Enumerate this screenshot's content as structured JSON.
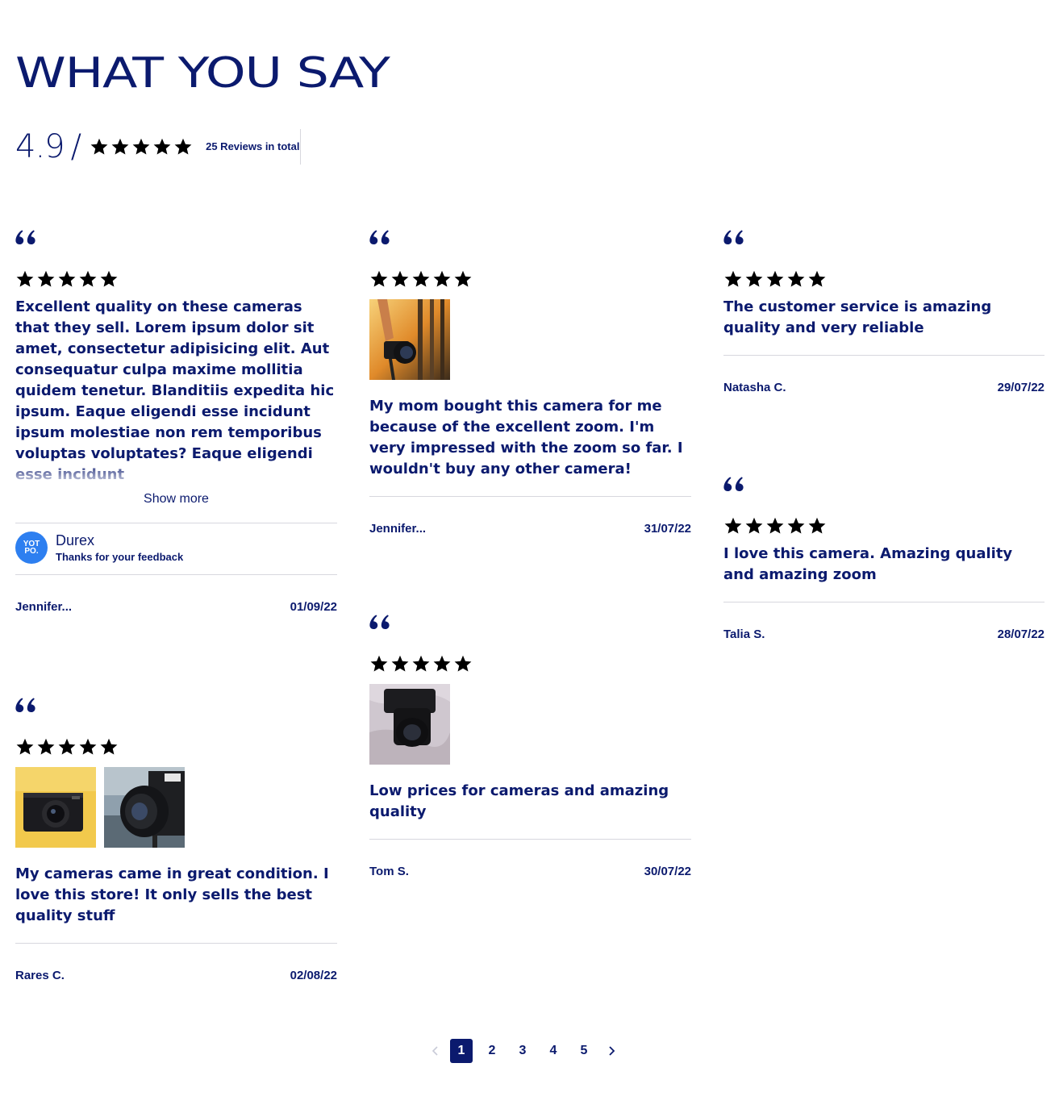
{
  "header": {
    "title": "WHAT YOU SAY"
  },
  "summary": {
    "score": "4.9",
    "slash": "/",
    "rating": 5,
    "total_label": "25 Reviews in total"
  },
  "colors": {
    "primary": "#0b1a6e",
    "star": "#1a34a8",
    "divider": "#d7d7de",
    "yotpo": "#2d7ff0"
  },
  "reviews": [
    {
      "rating": 5,
      "text": "Excellent quality on these cameras that they sell. Lorem ipsum dolor sit amet, consectetur adipisicing elit. Aut consequatur culpa maxime mollitia quidem tenetur. Blanditiis expedita hic ipsum. Eaque eligendi esse incidunt ipsum molestiae non rem temporibus voluptas voluptates?  Eaque eligendi esse incidunt",
      "show_more": "Show more",
      "reply": {
        "logo_text": "YOT PO.",
        "name": "Durex",
        "message": "Thanks for your feedback"
      },
      "author": "Jennifer...",
      "date": "01/09/22"
    },
    {
      "rating": 5,
      "photos": [
        "camera-in-hand-photo"
      ],
      "text": "My mom bought this camera for me because of the excellent zoom. I'm very impressed with the zoom so far. I wouldn't buy any other camera!",
      "author": "Jennifer...",
      "date": "31/07/22"
    },
    {
      "rating": 5,
      "text": "The customer service is amazing quality and very reliable",
      "author": "Natasha C.",
      "date": "29/07/22"
    },
    {
      "rating": 5,
      "photos": [
        "compact-camera-photo",
        "camera-lens-photo"
      ],
      "text": "My cameras came in great condition. I love this store! It only sells the best quality stuff",
      "author": "Rares C.",
      "date": "02/08/22"
    },
    {
      "rating": 5,
      "photos": [
        "camera-on-table-photo"
      ],
      "text": "Low prices for cameras and amazing quality",
      "author": "Tom S.",
      "date": "30/07/22"
    },
    {
      "rating": 5,
      "text": "I love this camera. Amazing quality and amazing zoom",
      "author": "Talia S.",
      "date": "28/07/22"
    }
  ],
  "pagination": {
    "pages": [
      "1",
      "2",
      "3",
      "4",
      "5"
    ],
    "current": "1"
  }
}
